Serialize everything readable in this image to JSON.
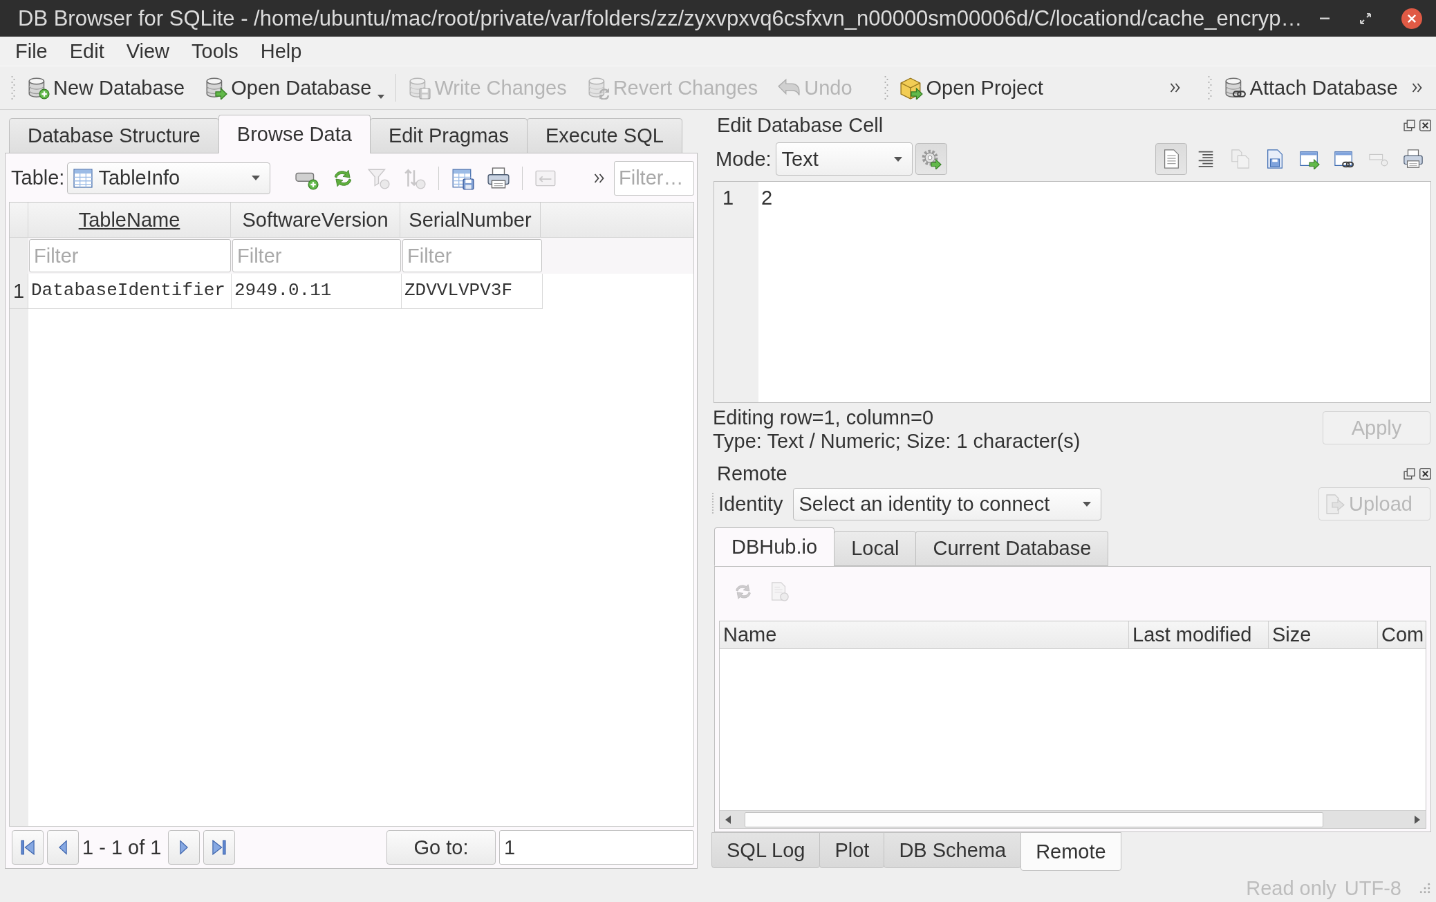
{
  "window": {
    "title": "DB Browser for SQLite - /home/ubuntu/mac/root/private/var/folders/zz/zyxvpxvq6csfxvn_n00000sm00006d/C/locationd/cache_encryp…"
  },
  "menu": [
    "File",
    "Edit",
    "View",
    "Tools",
    "Help"
  ],
  "toolbar": [
    {
      "items": [
        {
          "label": "New Database",
          "disabled": false
        },
        {
          "label": "Open Database",
          "disabled": false,
          "has_menu": true,
          "separator_after": true
        },
        {
          "label": "Write Changes",
          "disabled": true
        },
        {
          "label": "Revert Changes",
          "disabled": true
        },
        {
          "label": "Undo",
          "disabled": true
        }
      ]
    },
    {
      "overflow": true,
      "items": [
        {
          "label": "Open Project",
          "disabled": false
        }
      ]
    },
    {
      "overflow": true,
      "items": [
        {
          "label": "Attach Database",
          "disabled": false
        }
      ]
    }
  ],
  "tabs": [
    {
      "label": "Database Structure",
      "selected": false
    },
    {
      "label": "Browse Data",
      "selected": true
    },
    {
      "label": "Edit Pragmas",
      "selected": false
    },
    {
      "label": "Execute SQL",
      "selected": false
    }
  ],
  "browse": {
    "table_label": "Table:",
    "table_value": "TableInfo",
    "tools": [
      {
        "disabled": false
      },
      {
        "disabled": false
      },
      {
        "disabled": true
      },
      {
        "disabled": true,
        "separator_after": true
      },
      {
        "disabled": false
      },
      {
        "disabled": false,
        "separator_after": true
      },
      {
        "disabled": true
      }
    ],
    "overflow": true,
    "filter_placeholder": "Filter…",
    "columns": [
      {
        "name": "TableName",
        "underlined": true,
        "filter_placeholder": "Filter"
      },
      {
        "name": "SoftwareVersion",
        "underlined": false,
        "filter_placeholder": "Filter"
      },
      {
        "name": "SerialNumber",
        "underlined": false,
        "filter_placeholder": "Filter"
      }
    ],
    "rows": [
      {
        "header": "1",
        "cells": [
          "DatabaseIdentifier",
          "2949.0.11",
          "ZDVVLVPV3F"
        ]
      }
    ],
    "pager": {
      "status": "1 - 1 of 1",
      "goto_label": "Go to:",
      "goto_value": "1"
    }
  },
  "edit_cell": {
    "title": "Edit Database Cell",
    "mode_label": "Mode:",
    "mode_value": "Text",
    "auto_switch": {
      "checked": true
    },
    "tools": [
      {
        "checked": true,
        "disabled": false
      },
      {
        "checked": false,
        "disabled": false
      },
      {
        "checked": false,
        "disabled": true
      },
      {
        "checked": false,
        "disabled": false
      },
      {
        "checked": false,
        "disabled": false
      },
      {
        "checked": false,
        "disabled": false
      },
      {
        "checked": false,
        "disabled": true
      },
      {
        "checked": false,
        "disabled": false
      }
    ],
    "lines": [
      {
        "number": "1",
        "text": "2"
      }
    ],
    "info": [
      "Editing row=1, column=0",
      "Type: Text / Numeric; Size: 1 character(s)"
    ],
    "apply": {
      "label": "Apply",
      "disabled": true
    }
  },
  "remote": {
    "title": "Remote",
    "identity_label": "Identity",
    "identity_value": "Select an identity to connect",
    "upload": {
      "label": "Upload",
      "disabled": true
    },
    "tabs": [
      {
        "label": "DBHub.io",
        "selected": true
      },
      {
        "label": "Local",
        "selected": false
      },
      {
        "label": "Current Database",
        "selected": false
      }
    ],
    "tools": [
      {
        "disabled": true
      },
      {
        "disabled": true
      }
    ],
    "columns": [
      "Name",
      "Last modified",
      "Size",
      "Com"
    ]
  },
  "dock_tabs": [
    {
      "label": "SQL Log",
      "selected": false
    },
    {
      "label": "Plot",
      "selected": false
    },
    {
      "label": "DB Schema",
      "selected": false
    },
    {
      "label": "Remote",
      "selected": true
    }
  ],
  "status_bar": [
    {
      "text": "Read only",
      "disabled": true
    },
    {
      "text": "UTF-8",
      "disabled": true
    }
  ]
}
